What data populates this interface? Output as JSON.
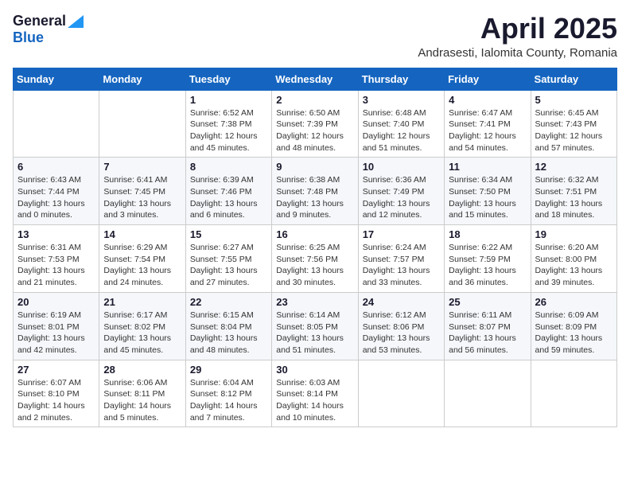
{
  "logo": {
    "general": "General",
    "blue": "Blue",
    "triangle_color": "#2196f3"
  },
  "title": {
    "month_year": "April 2025",
    "location": "Andrasesti, Ialomita County, Romania"
  },
  "weekdays": [
    "Sunday",
    "Monday",
    "Tuesday",
    "Wednesday",
    "Thursday",
    "Friday",
    "Saturday"
  ],
  "weeks": [
    [
      {
        "day": "",
        "info": ""
      },
      {
        "day": "",
        "info": ""
      },
      {
        "day": "1",
        "info": "Sunrise: 6:52 AM\nSunset: 7:38 PM\nDaylight: 12 hours\nand 45 minutes."
      },
      {
        "day": "2",
        "info": "Sunrise: 6:50 AM\nSunset: 7:39 PM\nDaylight: 12 hours\nand 48 minutes."
      },
      {
        "day": "3",
        "info": "Sunrise: 6:48 AM\nSunset: 7:40 PM\nDaylight: 12 hours\nand 51 minutes."
      },
      {
        "day": "4",
        "info": "Sunrise: 6:47 AM\nSunset: 7:41 PM\nDaylight: 12 hours\nand 54 minutes."
      },
      {
        "day": "5",
        "info": "Sunrise: 6:45 AM\nSunset: 7:43 PM\nDaylight: 12 hours\nand 57 minutes."
      }
    ],
    [
      {
        "day": "6",
        "info": "Sunrise: 6:43 AM\nSunset: 7:44 PM\nDaylight: 13 hours\nand 0 minutes."
      },
      {
        "day": "7",
        "info": "Sunrise: 6:41 AM\nSunset: 7:45 PM\nDaylight: 13 hours\nand 3 minutes."
      },
      {
        "day": "8",
        "info": "Sunrise: 6:39 AM\nSunset: 7:46 PM\nDaylight: 13 hours\nand 6 minutes."
      },
      {
        "day": "9",
        "info": "Sunrise: 6:38 AM\nSunset: 7:48 PM\nDaylight: 13 hours\nand 9 minutes."
      },
      {
        "day": "10",
        "info": "Sunrise: 6:36 AM\nSunset: 7:49 PM\nDaylight: 13 hours\nand 12 minutes."
      },
      {
        "day": "11",
        "info": "Sunrise: 6:34 AM\nSunset: 7:50 PM\nDaylight: 13 hours\nand 15 minutes."
      },
      {
        "day": "12",
        "info": "Sunrise: 6:32 AM\nSunset: 7:51 PM\nDaylight: 13 hours\nand 18 minutes."
      }
    ],
    [
      {
        "day": "13",
        "info": "Sunrise: 6:31 AM\nSunset: 7:53 PM\nDaylight: 13 hours\nand 21 minutes."
      },
      {
        "day": "14",
        "info": "Sunrise: 6:29 AM\nSunset: 7:54 PM\nDaylight: 13 hours\nand 24 minutes."
      },
      {
        "day": "15",
        "info": "Sunrise: 6:27 AM\nSunset: 7:55 PM\nDaylight: 13 hours\nand 27 minutes."
      },
      {
        "day": "16",
        "info": "Sunrise: 6:25 AM\nSunset: 7:56 PM\nDaylight: 13 hours\nand 30 minutes."
      },
      {
        "day": "17",
        "info": "Sunrise: 6:24 AM\nSunset: 7:57 PM\nDaylight: 13 hours\nand 33 minutes."
      },
      {
        "day": "18",
        "info": "Sunrise: 6:22 AM\nSunset: 7:59 PM\nDaylight: 13 hours\nand 36 minutes."
      },
      {
        "day": "19",
        "info": "Sunrise: 6:20 AM\nSunset: 8:00 PM\nDaylight: 13 hours\nand 39 minutes."
      }
    ],
    [
      {
        "day": "20",
        "info": "Sunrise: 6:19 AM\nSunset: 8:01 PM\nDaylight: 13 hours\nand 42 minutes."
      },
      {
        "day": "21",
        "info": "Sunrise: 6:17 AM\nSunset: 8:02 PM\nDaylight: 13 hours\nand 45 minutes."
      },
      {
        "day": "22",
        "info": "Sunrise: 6:15 AM\nSunset: 8:04 PM\nDaylight: 13 hours\nand 48 minutes."
      },
      {
        "day": "23",
        "info": "Sunrise: 6:14 AM\nSunset: 8:05 PM\nDaylight: 13 hours\nand 51 minutes."
      },
      {
        "day": "24",
        "info": "Sunrise: 6:12 AM\nSunset: 8:06 PM\nDaylight: 13 hours\nand 53 minutes."
      },
      {
        "day": "25",
        "info": "Sunrise: 6:11 AM\nSunset: 8:07 PM\nDaylight: 13 hours\nand 56 minutes."
      },
      {
        "day": "26",
        "info": "Sunrise: 6:09 AM\nSunset: 8:09 PM\nDaylight: 13 hours\nand 59 minutes."
      }
    ],
    [
      {
        "day": "27",
        "info": "Sunrise: 6:07 AM\nSunset: 8:10 PM\nDaylight: 14 hours\nand 2 minutes."
      },
      {
        "day": "28",
        "info": "Sunrise: 6:06 AM\nSunset: 8:11 PM\nDaylight: 14 hours\nand 5 minutes."
      },
      {
        "day": "29",
        "info": "Sunrise: 6:04 AM\nSunset: 8:12 PM\nDaylight: 14 hours\nand 7 minutes."
      },
      {
        "day": "30",
        "info": "Sunrise: 6:03 AM\nSunset: 8:14 PM\nDaylight: 14 hours\nand 10 minutes."
      },
      {
        "day": "",
        "info": ""
      },
      {
        "day": "",
        "info": ""
      },
      {
        "day": "",
        "info": ""
      }
    ]
  ]
}
